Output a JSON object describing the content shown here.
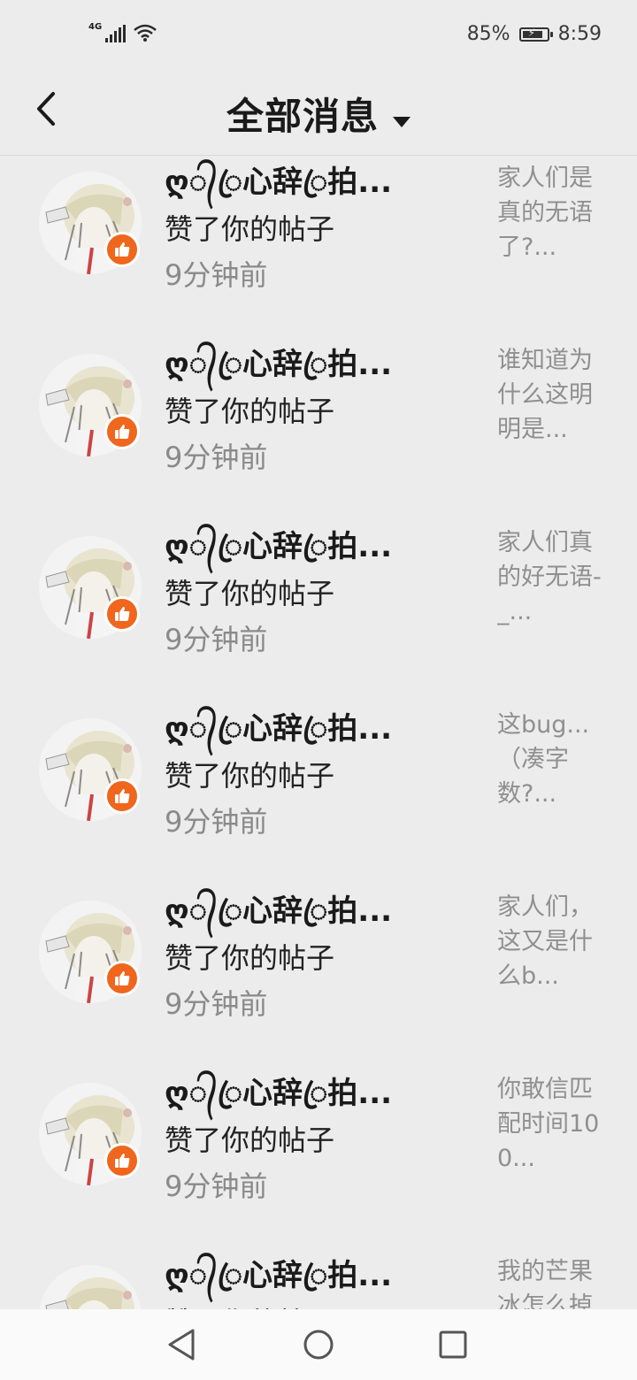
{
  "status": {
    "network": "4G",
    "battery_text": "85%",
    "battery_level": 0.85,
    "time": "8:59"
  },
  "header": {
    "title": "全部消息"
  },
  "notifications": [
    {
      "user": "ღ᭄ꦿ心辞ꦿ拍...",
      "action": "赞了你的帖子",
      "time": "9分钟前",
      "preview": "家人们是真的无语了?..."
    },
    {
      "user": "ღ᭄ꦿ心辞ꦿ拍...",
      "action": "赞了你的帖子",
      "time": "9分钟前",
      "preview": "谁知道为什么这明明是..."
    },
    {
      "user": "ღ᭄ꦿ心辞ꦿ拍...",
      "action": "赞了你的帖子",
      "time": "9分钟前",
      "preview": "家人们真的好无语-_..."
    },
    {
      "user": "ღ᭄ꦿ心辞ꦿ拍...",
      "action": "赞了你的帖子",
      "time": "9分钟前",
      "preview": "这bug...（凑字数?..."
    },
    {
      "user": "ღ᭄ꦿ心辞ꦿ拍...",
      "action": "赞了你的帖子",
      "time": "9分钟前",
      "preview": "家人们，这又是什么b..."
    },
    {
      "user": "ღ᭄ꦿ心辞ꦿ拍...",
      "action": "赞了你的帖子",
      "time": "9分钟前",
      "preview": "你敢信匹配时间100..."
    },
    {
      "user": "ღ᭄ꦿ心辞ꦿ拍...",
      "action": "赞了你的帖子",
      "time": "",
      "preview": "我的芒果冰怎么掉各了..."
    }
  ],
  "colors": {
    "accent": "#f0661d",
    "background": "#ececec"
  }
}
